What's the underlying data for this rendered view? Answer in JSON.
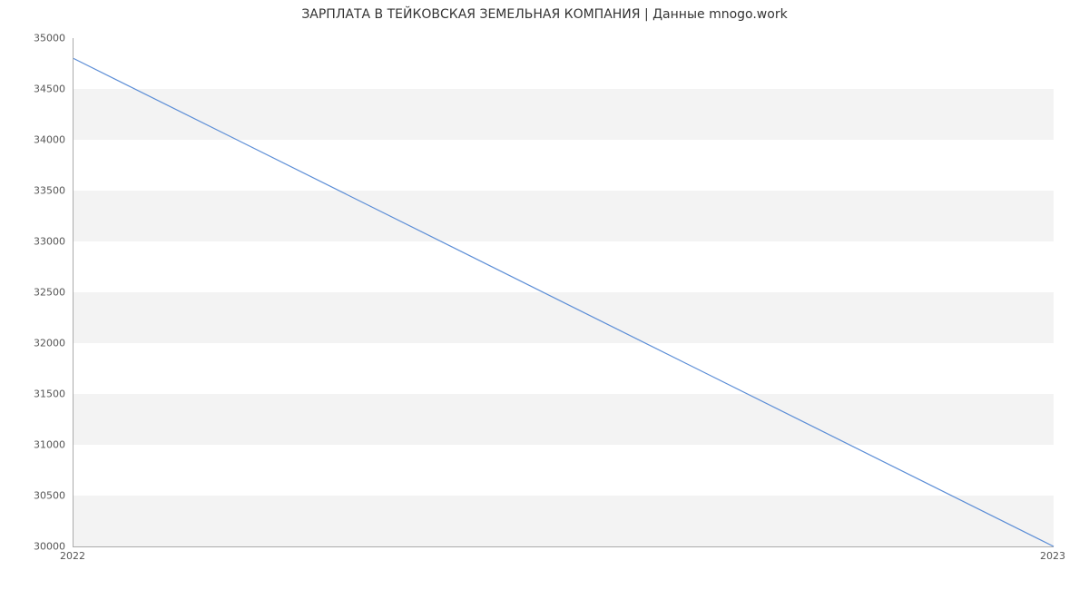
{
  "chart_data": {
    "type": "line",
    "title": "ЗАРПЛАТА В ТЕЙКОВСКАЯ ЗЕМЕЛЬНАЯ КОМПАНИЯ | Данные mnogo.work",
    "xlabel": "",
    "ylabel": "",
    "x": [
      2022,
      2023
    ],
    "values": [
      34800,
      30000
    ],
    "yticks": [
      30000,
      30500,
      31000,
      31500,
      32000,
      32500,
      33000,
      33500,
      34000,
      34500,
      35000
    ],
    "xticks": [
      2022,
      2023
    ],
    "ylim": [
      30000,
      35000
    ],
    "xlim": [
      2022,
      2023
    ],
    "grid": true
  }
}
